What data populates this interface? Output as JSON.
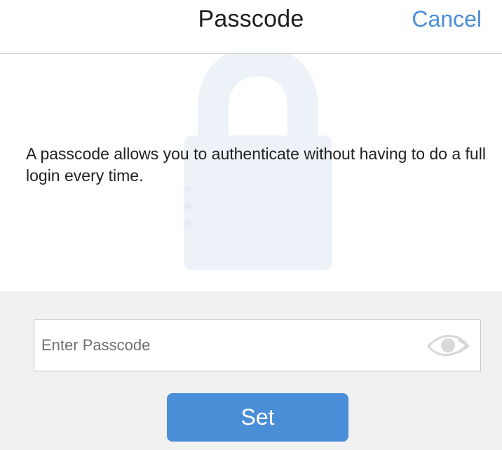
{
  "header": {
    "title": "Passcode",
    "cancel_label": "Cancel"
  },
  "content": {
    "description": "A passcode allows you to authenticate without having to do a full login every time.",
    "watermark_icon": "lock-icon"
  },
  "form": {
    "passcode_placeholder": "Enter Passcode",
    "passcode_value": "",
    "visibility_icon": "eye-icon",
    "submit_label": "Set"
  },
  "colors": {
    "accent": "#4a8ed8",
    "panel_background": "#f1f1f1",
    "divider": "#c9c9c9",
    "watermark": "#edf2f8"
  }
}
